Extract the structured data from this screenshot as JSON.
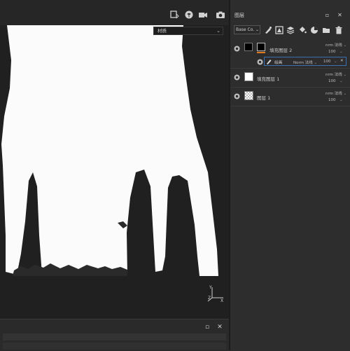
{
  "viewport": {
    "channel_select": "材质",
    "toolbar_icons": [
      "camera-frame-icon",
      "cube-icon",
      "video-camera-icon",
      "screenshot-icon"
    ]
  },
  "layers_panel": {
    "title": "图层",
    "blend_mode": "Base Co.",
    "layers": [
      {
        "name": "填充图层 2",
        "blend": "nrm",
        "blend_suffix": "法线",
        "opacity": "100",
        "selected": true
      },
      {
        "name": "绘画",
        "blend": "Norm",
        "blend_suffix": "法线",
        "opacity": "100",
        "is_effect": true
      },
      {
        "name": "填充图层 1",
        "blend": "nrm",
        "blend_suffix": "法线",
        "opacity": "100"
      },
      {
        "name": "图层 1",
        "blend": "nrm",
        "blend_suffix": "法线",
        "opacity": "100"
      }
    ]
  },
  "gizmo": {
    "axes": [
      "Y",
      "Z",
      "X"
    ]
  },
  "colors": {
    "accent": "#e07a1f",
    "panel": "#2d2d2d",
    "viewport": "#202020",
    "selection": "#3d6fb5"
  }
}
